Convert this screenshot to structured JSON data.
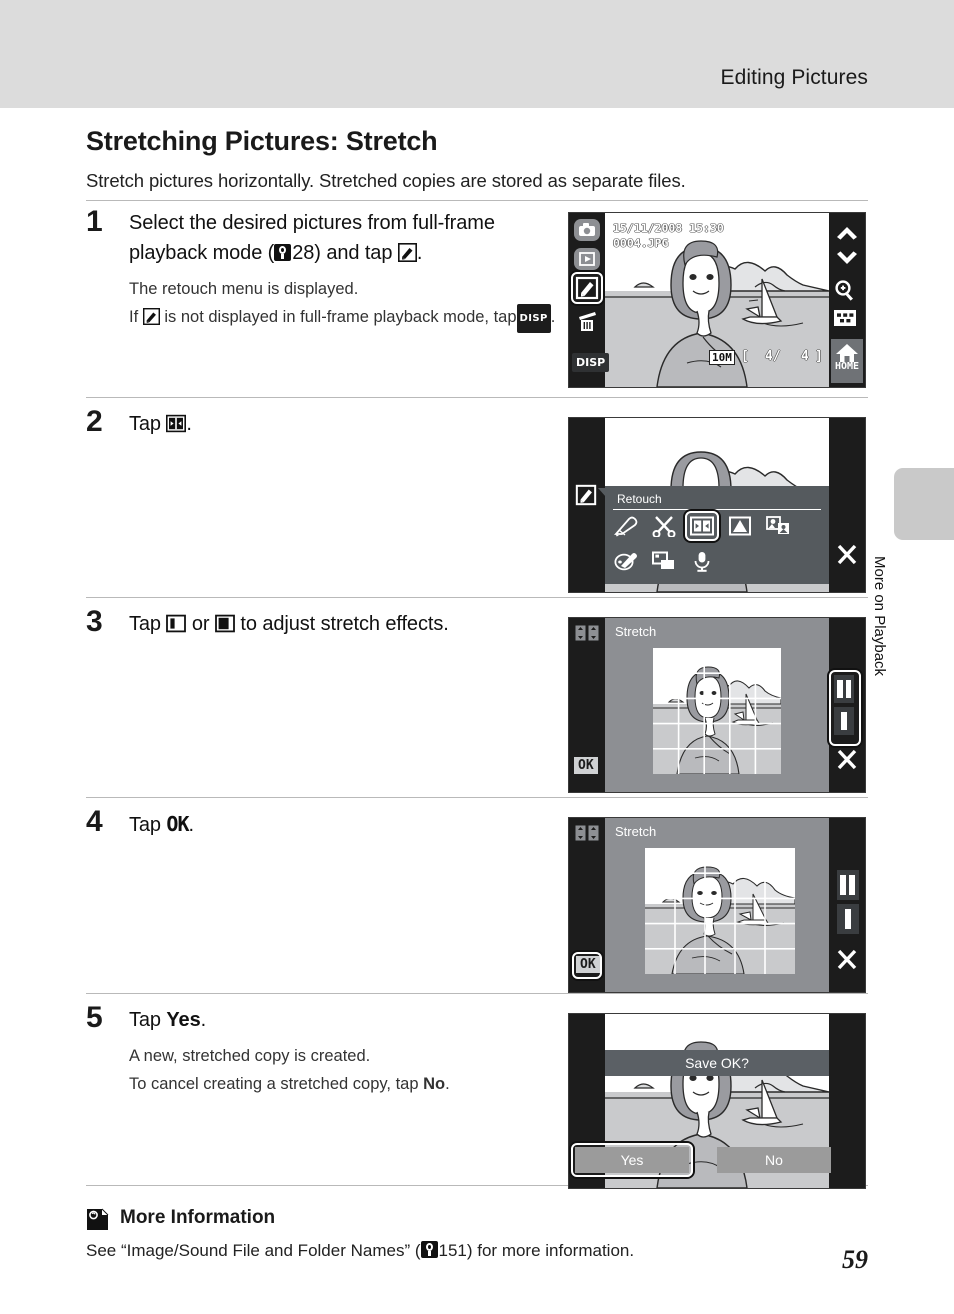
{
  "header": {
    "title": "Editing Pictures"
  },
  "side_tab": {
    "label": "More on Playback"
  },
  "section": {
    "title": "Stretching Pictures: Stretch",
    "intro": "Stretch pictures horizontally. Stretched copies are stored as separate files."
  },
  "steps": [
    {
      "number": "1",
      "head_part1": "Select the desired pictures from full-frame playback mode (",
      "head_ref": "28",
      "head_part2": ") and tap",
      "head_part3": ".",
      "sub_line1": "The retouch menu is displayed.",
      "sub_line2_a": "If",
      "sub_line2_b": "is not displayed in full-frame playback mode, tap",
      "sub_line2_c": "."
    },
    {
      "number": "2",
      "head_part1": "Tap",
      "head_part3": "."
    },
    {
      "number": "3",
      "head_part1": "Tap",
      "head_mid": "or",
      "head_part3": "to adjust stretch effects."
    },
    {
      "number": "4",
      "head_part1": "Tap",
      "head_ok": "OK",
      "head_part3": "."
    },
    {
      "number": "5",
      "head_part1": "Tap",
      "head_bold": "Yes",
      "head_part3": ".",
      "sub_line1": "A new, stretched copy is created.",
      "sub_line2_a": "To cancel creating a stretched copy, tap",
      "sub_line2_bold": "No",
      "sub_line2_c": "."
    }
  ],
  "more_information": {
    "title": "More Information",
    "text_a": "See “Image/Sound File and Folder Names” (",
    "ref": "151",
    "text_b": ") for more information."
  },
  "page_number": "59",
  "screens": {
    "playback": {
      "date": "15/11/2008  15:30",
      "filename": "0004.JPG",
      "image_size": "10M",
      "frame_counter_left": "4/",
      "frame_counter_right": "4",
      "disp_label": "DISP",
      "home_label": "HOME",
      "left_icons": [
        "camera-icon",
        "playback-icon",
        "retouch-icon",
        "delete-icon",
        "disp-icon"
      ],
      "right_icons": [
        "chevron-up-icon",
        "chevron-down-icon",
        "zoom-in-icon",
        "thumbnail-grid-icon",
        "home-icon"
      ]
    },
    "retouch_menu": {
      "title": "Retouch",
      "items": [
        "quick-retouch-icon",
        "crop-icon",
        "stretch-icon",
        "d-lighting-icon",
        "small-picture-icon",
        "paint-icon",
        "frame-icon",
        "voice-memo-icon"
      ],
      "selected": "stretch-icon",
      "close_label": "close-icon"
    },
    "stretch_adjust": {
      "title": "Stretch",
      "ok_label": "OK",
      "stretch_icon": "stretch-icon",
      "level_buttons": [
        "stretch-low-icon",
        "stretch-high-icon"
      ],
      "close_label": "close-icon"
    },
    "stretch_confirm": {
      "title": "Stretch",
      "ok_label": "OK",
      "stretch_icon": "stretch-icon",
      "level_buttons": [
        "stretch-low-icon",
        "stretch-high-icon"
      ],
      "close_label": "close-icon"
    },
    "save_dialog": {
      "prompt": "Save OK?",
      "yes_label": "Yes",
      "no_label": "No",
      "selected": "Yes"
    }
  },
  "colors": {
    "header_band": "#dcdcdc",
    "side_tab": "#c9c9c9",
    "lcd_body": "#1c1c1c",
    "menu_panel": "#555a5e",
    "rule": "#b9b9b9"
  }
}
